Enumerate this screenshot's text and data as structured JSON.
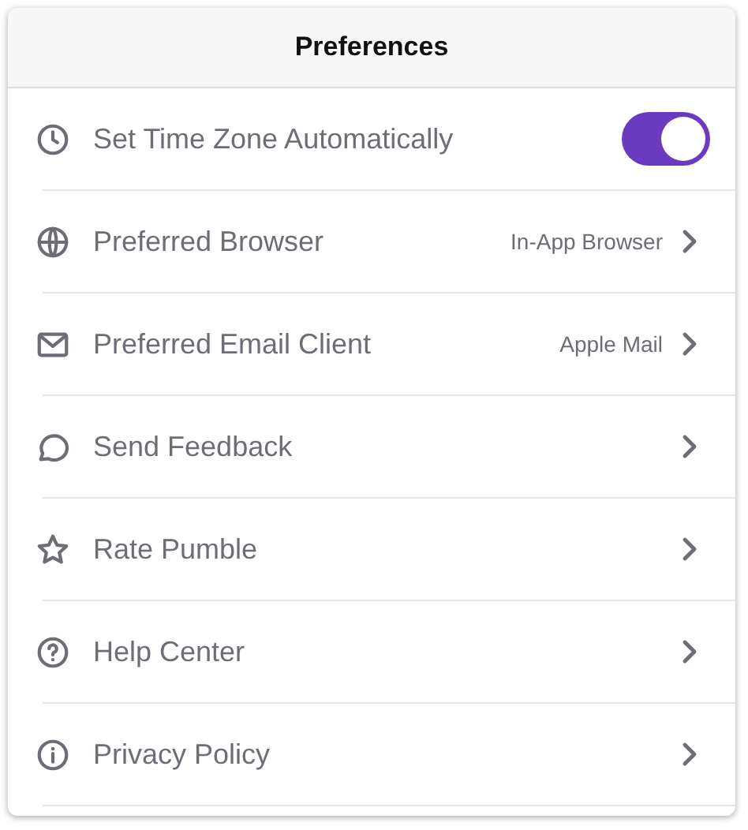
{
  "window": {
    "title": "Preferences"
  },
  "items": [
    {
      "kind": "toggle",
      "label": "Set Time Zone Automatically",
      "on": true
    },
    {
      "kind": "link",
      "label": "Preferred Browser",
      "value": "In-App Browser"
    },
    {
      "kind": "link",
      "label": "Preferred Email Client",
      "value": "Apple Mail"
    },
    {
      "kind": "link",
      "label": "Send Feedback"
    },
    {
      "kind": "link",
      "label": "Rate Pumble"
    },
    {
      "kind": "link",
      "label": "Help Center"
    },
    {
      "kind": "link",
      "label": "Privacy Policy"
    }
  ]
}
